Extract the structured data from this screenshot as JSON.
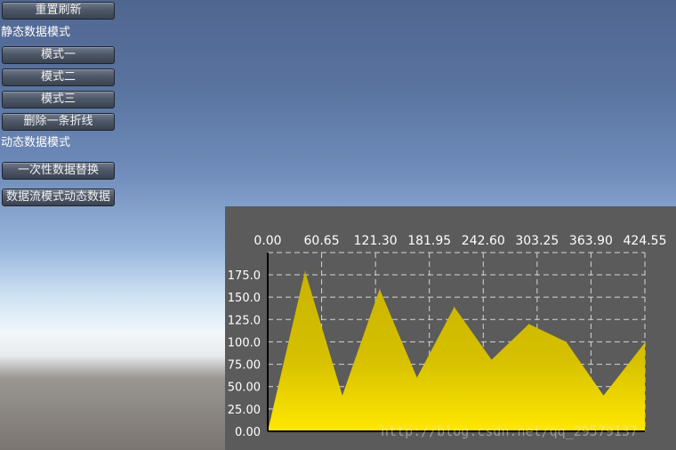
{
  "controls": {
    "reset_refresh": "重置刷新",
    "static_mode_label": "静态数据模式",
    "mode_one": "模式一",
    "mode_two": "模式二",
    "mode_three": "模式三",
    "delete_line": "删除一条折线",
    "dynamic_mode_label": "动态数据模式",
    "one_time_replace": "一次性数据替换",
    "stream_mode": "数据流模式动态数据"
  },
  "watermark": "http://blog.csdn.net/qq_29579137",
  "colors": {
    "panel_bg": "#5b5b5b",
    "fill_top": "#c9b300",
    "fill_bottom": "#ffe800",
    "grid": "#d6d6d6",
    "text": "#ffffff"
  },
  "chart_data": {
    "type": "area",
    "x_tick_labels": [
      "0.00",
      "60.65",
      "121.30",
      "181.95",
      "242.60",
      "303.25",
      "363.90",
      "424.55"
    ],
    "y_tick_labels": [
      "0.00",
      "25.00",
      "50.00",
      "75.00",
      "100.0",
      "125.0",
      "150.0",
      "175.0"
    ],
    "xlim": [
      0,
      424.55
    ],
    "ylim": [
      0,
      175
    ],
    "grid": true,
    "x_axis_position": "top",
    "series": [
      {
        "x": [
          0,
          42,
          84,
          126,
          168,
          210,
          252,
          294,
          336,
          378,
          424.55
        ],
        "y": [
          0,
          179,
          40,
          159,
          60,
          139,
          80,
          120,
          100,
          40,
          99
        ]
      }
    ]
  }
}
